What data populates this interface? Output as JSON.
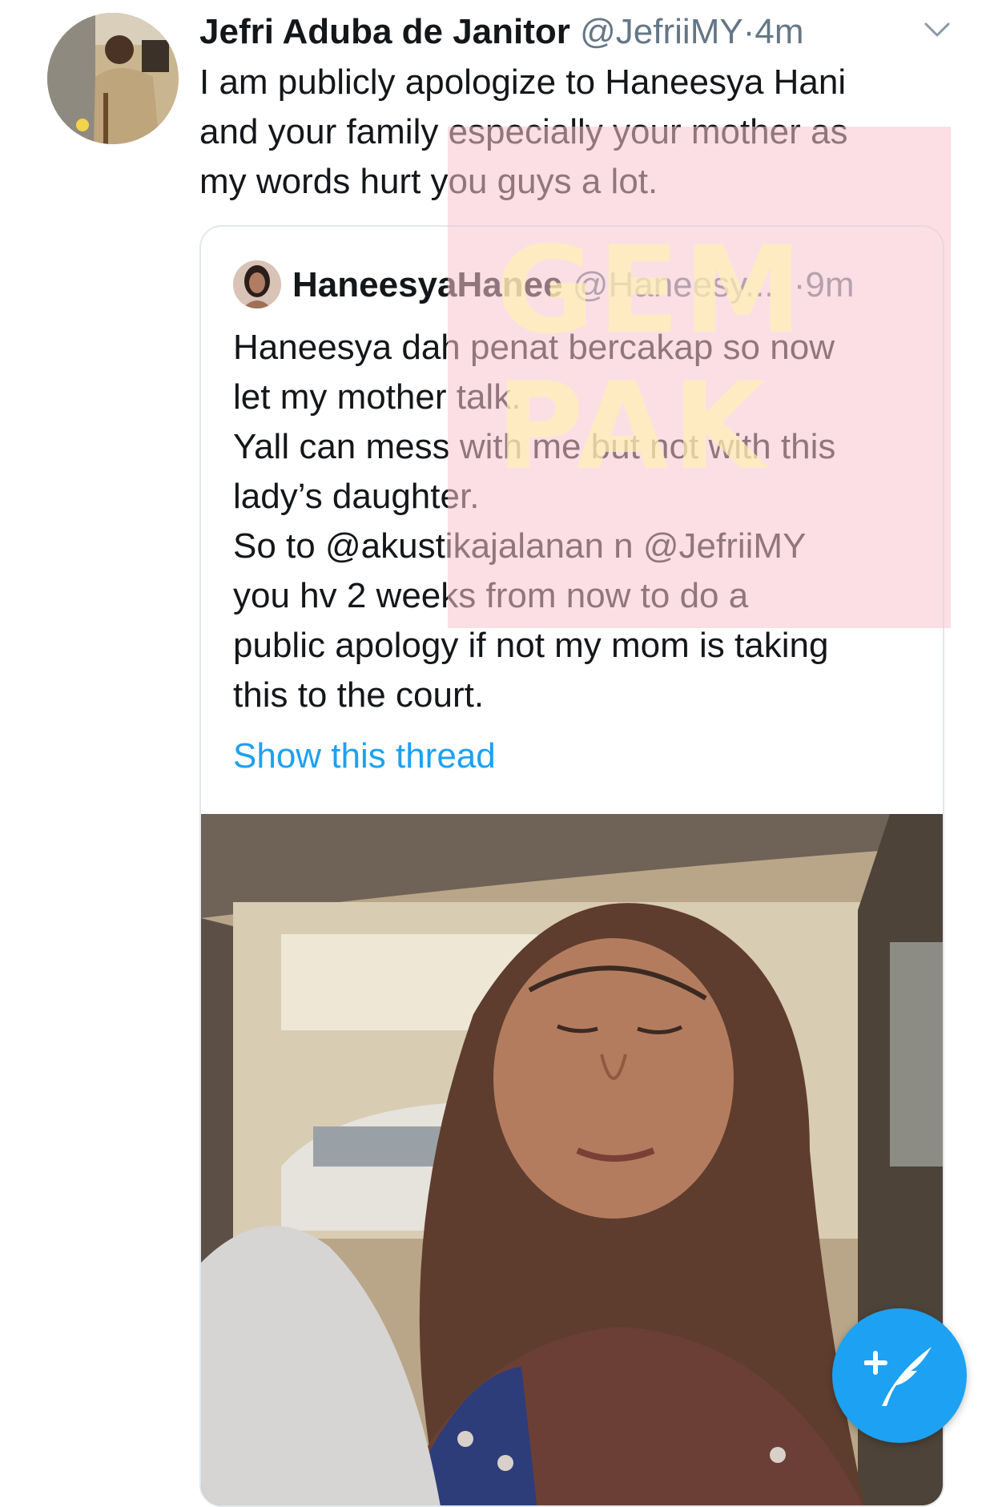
{
  "tweet": {
    "author_name": "Jefri Aduba de Janitor",
    "author_handle": "@JefriiMY",
    "separator": "·",
    "timestamp": "4m",
    "text": "I am publicly apologize to Haneesya Hani\nand your family especially your mother as\nmy words hurt you guys a lot.",
    "avatar_icon": "person-avatar-icon",
    "menu_icon": "chevron-down-icon"
  },
  "quoted": {
    "author_name": "HaneesyaHanee",
    "author_handle": "@Haneesy...",
    "timestamp": "·9m",
    "text": "Haneesya dah penat bercakap so now\nlet my mother talk.\nYall can mess with me but not with this\nlady’s daughter.\nSo to @akustikajalanan n @JefriiMY\nyou hv 2 weeks from now to do a\npublic apology if not my mom is taking\nthis to the court.",
    "show_thread": "Show this thread",
    "avatar_icon": "person-avatar-icon"
  },
  "media": {
    "description_icon": "video-thumbnail"
  },
  "watermark": {
    "text": "GEM\nPAK"
  },
  "compose": {
    "icon": "compose-tweet-icon"
  },
  "colors": {
    "link": "#1da1f2",
    "secondary_text": "#657786",
    "primary_text": "#14171a",
    "border": "#e1e8ed",
    "watermark": "#f8c4d0"
  }
}
